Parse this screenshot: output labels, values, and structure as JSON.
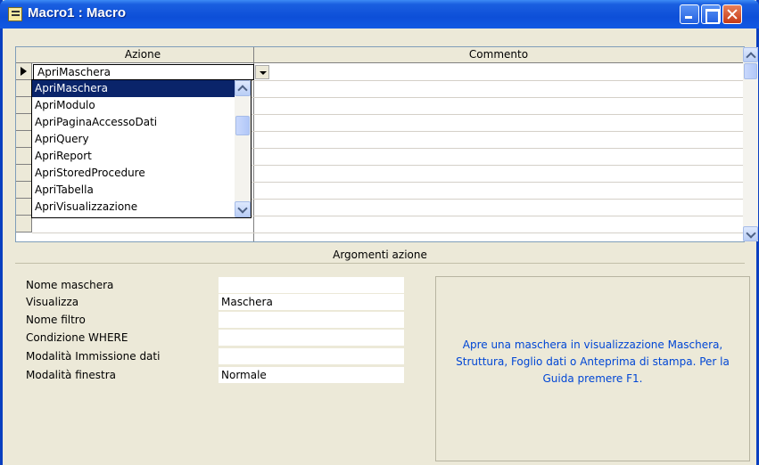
{
  "window": {
    "title": "Macro1 : Macro"
  },
  "grid": {
    "col_azione": "Azione",
    "col_commento": "Commento",
    "current_value": "ApriMaschera"
  },
  "dropdown": {
    "items": [
      "ApriMaschera",
      "ApriModulo",
      "ApriPaginaAccessoDati",
      "ApriQuery",
      "ApriReport",
      "ApriStoredProcedure",
      "ApriTabella",
      "ApriVisualizzazione"
    ],
    "selected_index": 0
  },
  "args": {
    "header": "Argomenti azione",
    "fields": [
      {
        "label": "Nome maschera",
        "value": ""
      },
      {
        "label": "Visualizza",
        "value": "Maschera"
      },
      {
        "label": "Nome filtro",
        "value": ""
      },
      {
        "label": "Condizione WHERE",
        "value": ""
      },
      {
        "label": "Modalità Immissione dati",
        "value": ""
      },
      {
        "label": "Modalità finestra",
        "value": "Normale"
      }
    ],
    "help_text": "Apre una maschera in visualizzazione Maschera, Struttura, Foglio dati o Anteprima di stampa. Per la Guida premere F1."
  }
}
